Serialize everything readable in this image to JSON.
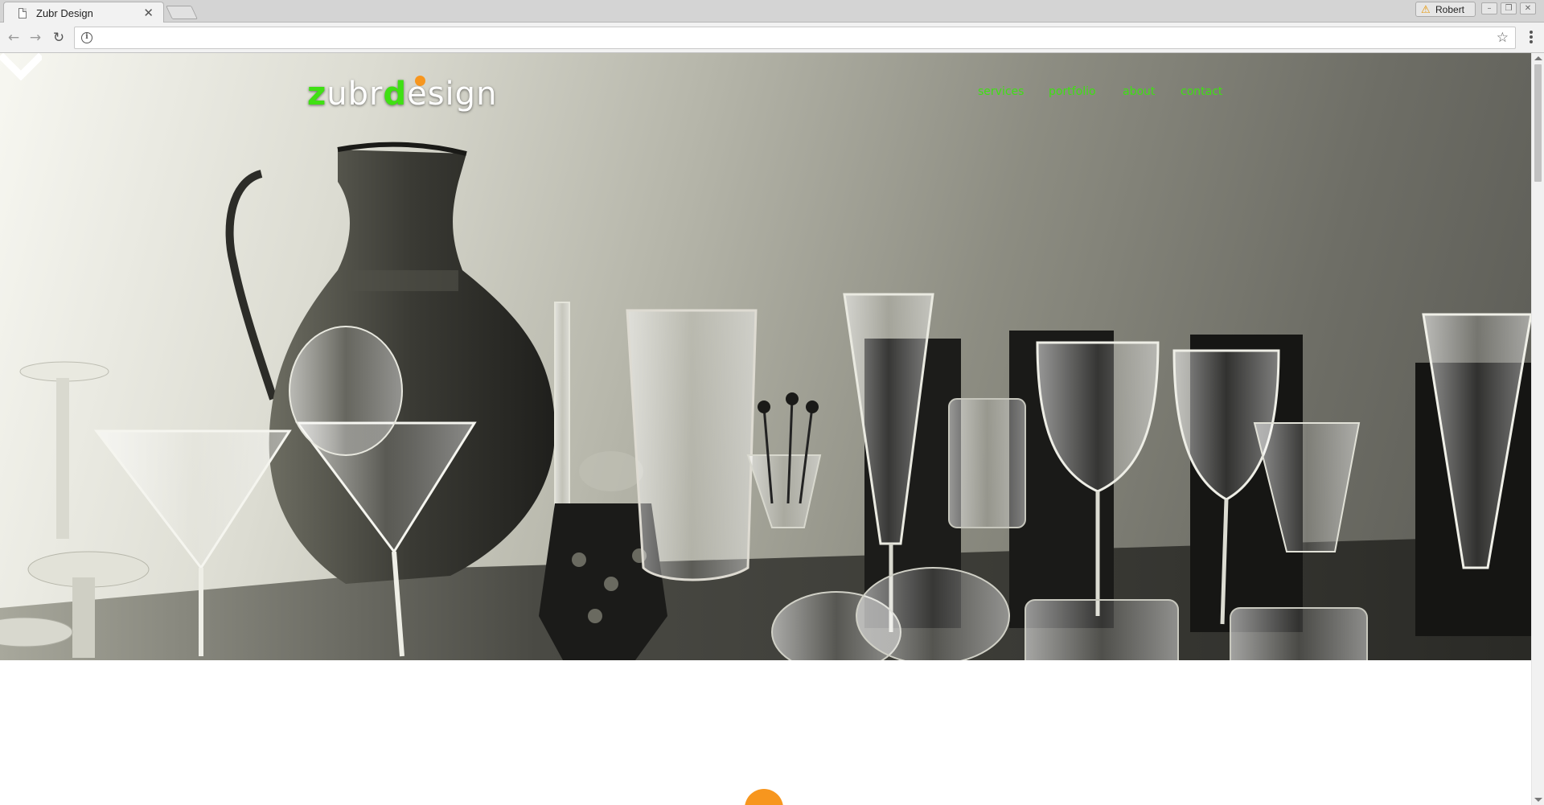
{
  "browser": {
    "tab_title": "Zubr Design",
    "tab_close": "✕",
    "profile_name": "Robert",
    "url": "",
    "window_buttons": [
      "–",
      "❐",
      "✕"
    ]
  },
  "site": {
    "logo_parts": {
      "z": "z",
      "ubr": "ubr",
      "d": "d",
      "esign": "esign"
    },
    "nav": {
      "services": "services",
      "portfolio": "portfolio",
      "about": "about",
      "contact": "contact"
    }
  },
  "colors": {
    "brand_green": "#3fe013",
    "brand_orange": "#f7961e",
    "hero_tone": "#8d8d82"
  },
  "icons": {
    "back": "arrow-left-icon",
    "forward": "arrow-right-icon",
    "reload": "reload-icon",
    "site_info": "info-icon",
    "bookmark": "star-icon",
    "menu": "kebab-menu-icon",
    "scroll_down": "chevron-down-icon"
  }
}
